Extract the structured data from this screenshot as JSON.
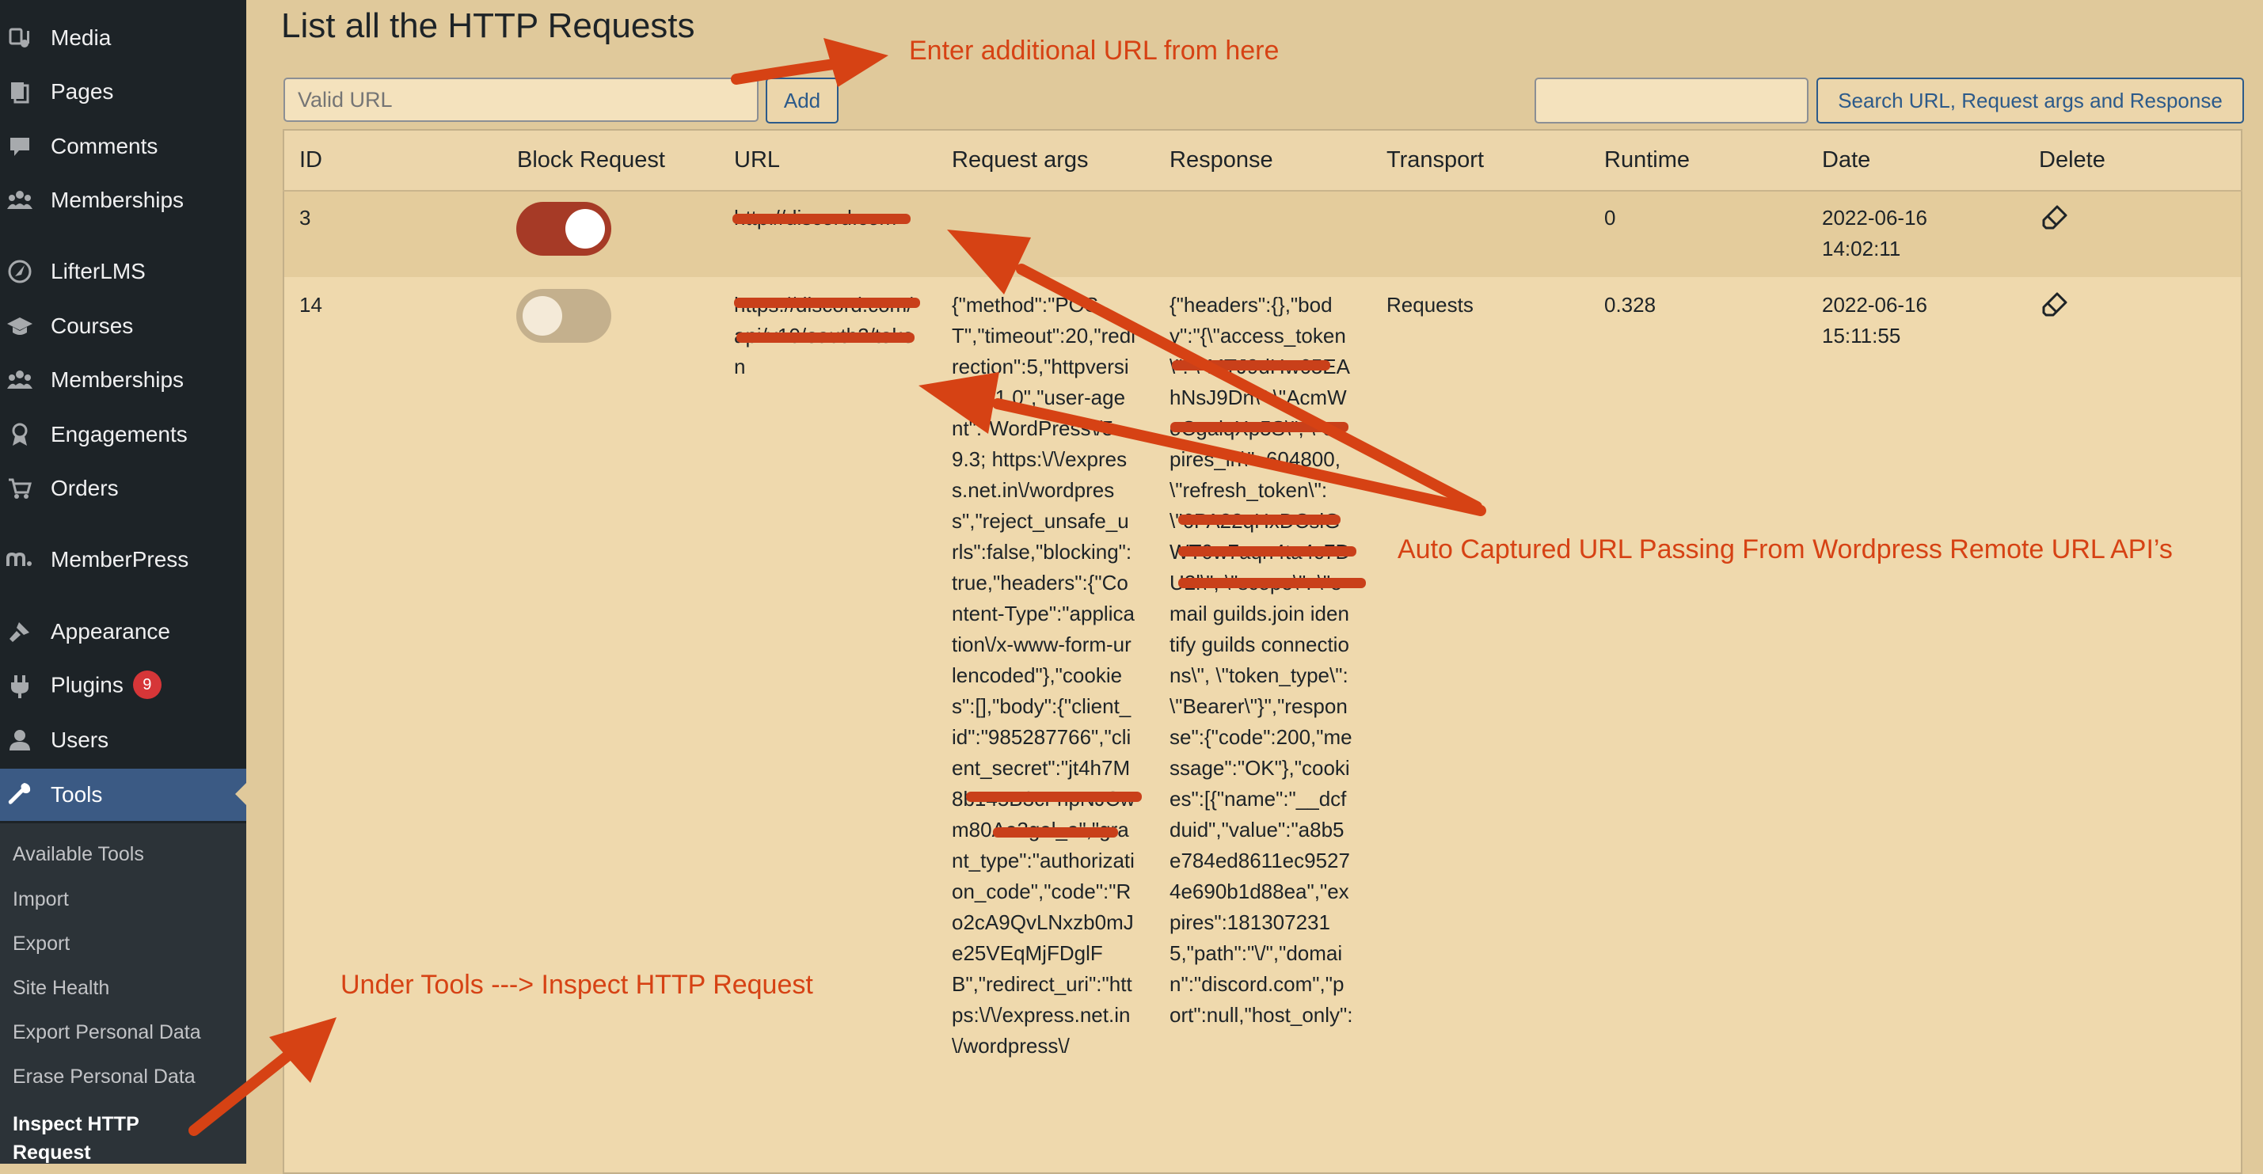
{
  "sidebar": {
    "items": [
      {
        "label": "Media",
        "icon": "media-icon"
      },
      {
        "label": "Pages",
        "icon": "pages-icon"
      },
      {
        "label": "Comments",
        "icon": "comments-icon"
      },
      {
        "label": "Memberships",
        "icon": "memberships-icon"
      },
      {
        "label": "LifterLMS",
        "icon": "lifterlms-icon"
      },
      {
        "label": "Courses",
        "icon": "courses-icon"
      },
      {
        "label": "Memberships",
        "icon": "memberships-icon"
      },
      {
        "label": "Engagements",
        "icon": "engagements-icon"
      },
      {
        "label": "Orders",
        "icon": "orders-cart-icon"
      },
      {
        "label": "MemberPress",
        "icon": "memberpress-icon"
      },
      {
        "label": "Appearance",
        "icon": "appearance-brush-icon"
      },
      {
        "label": "Plugins",
        "icon": "plugins-icon",
        "badge": "9"
      },
      {
        "label": "Users",
        "icon": "users-icon"
      },
      {
        "label": "Tools",
        "icon": "tools-wrench-icon",
        "active": true
      }
    ],
    "submenu": [
      "Available Tools",
      "Import",
      "Export",
      "Site Health",
      "Export Personal Data",
      "Erase Personal Data",
      "Inspect HTTP Request"
    ]
  },
  "page": {
    "title": "List all the HTTP Requests",
    "url_input_placeholder": "Valid URL",
    "add_label": "Add",
    "search_value": "",
    "search_label": "Search URL, Request args and Response"
  },
  "table": {
    "headers": [
      "ID",
      "Block Request",
      "URL",
      "Request args",
      "Response",
      "Transport",
      "Runtime",
      "Date",
      "Delete"
    ],
    "rows": [
      {
        "id": "3",
        "blocked": true,
        "url": "http://discord.com",
        "request_args": "",
        "response": "",
        "transport": "",
        "runtime": "0",
        "date": "2022-06-16 14:02:11"
      },
      {
        "id": "14",
        "blocked": false,
        "url": "https://discord.com/api/v10/oauth2/token",
        "request_args": "{\"method\":\"POST\",\"timeout\":20,\"redirection\":5,\"httpversion\":\"1.0\",\"user-agent\":\"WordPress\\/5.9.3; https:\\/\\/express.net.in\\/wordpress\",\"reject_unsafe_urls\":false,\"blocking\":true,\"headers\":{\"Content-Type\":\"application\\/x-www-form-urlencoded\"},\"cookies\":[],\"body\":{\"client_id\":\"985287766\",\"client_secret\":\"jt4h7M8b145B3cFnpNJCwm80Ae2gel_a\",\"grant_type\":\"authorization_code\",\"code\":\"Ro2cA9QvLNxzb0mJe25VEqMjFDglFB\",\"redirect_uri\":\"https:\\/\\/express.net.in\\/wordpress\\/",
        "response": "{\"headers\":{},\"body\":\"{\\\"access_token\\\": \\\"MTJ9dHw65EAhNsJ9Dn\\\" \\\"AcmWoCgaiqXp5S\\\", \\\"expires_in\\\": 604800, \\\"refresh_token\\\": \\\"6PA22qHxDCslGWT0w7aqn4ta4c7DU2l\\\", \\\"scope\\\": \\\"email guilds.join identify guilds connections\\\", \\\"token_type\\\": \\\"Bearer\\\"}\",\"response\":{\"code\":200,\"message\":\"OK\"},\"cookies\":[{\"name\":\"__dcfduid\",\"value\":\"a8b5e784ed8611ec95274e690b1d88ea\",\"expires\":1813072315,\"path\":\"\\/\",\"domain\":\"discord.com\",\"port\":null,\"host_only\":",
        "transport": "Requests",
        "runtime": "0.328",
        "date": "2022-06-16 15:11:55"
      }
    ]
  },
  "annotations": {
    "enter_url": "Enter additional URL from here",
    "auto_captured": "Auto Captured URL Passing From Wordpress Remote URL API’s",
    "under_tools": "Under  Tools --->  Inspect HTTP Request"
  },
  "colors": {
    "sidebar_bg": "#1d2327",
    "active_menu": "#3b5a84",
    "page_bg": "#e0c99b",
    "annotation": "#d64214",
    "toggle_on": "#a63a26"
  }
}
